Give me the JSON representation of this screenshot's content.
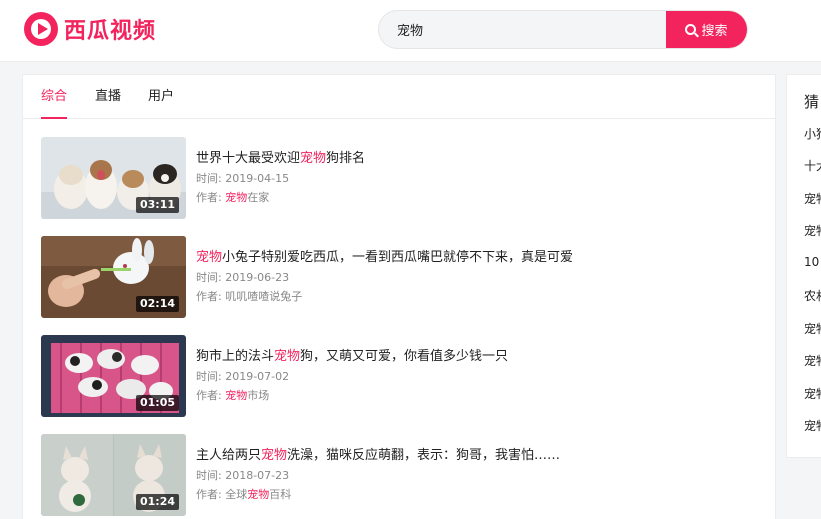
{
  "logo": {
    "text": "西瓜视频",
    "brand_color": "#f2235d"
  },
  "search": {
    "value": "宠物",
    "button_label": "搜索"
  },
  "tabs": [
    {
      "label": "综合",
      "active": true
    },
    {
      "label": "直播",
      "active": false
    },
    {
      "label": "用户",
      "active": false
    }
  ],
  "videos": [
    {
      "title_pre": "世界十大最受欢迎",
      "title_hl": "宠物",
      "title_post": "狗排名",
      "time_label": "时间: ",
      "time": "2019-04-15",
      "author_label": "作者: ",
      "author_hl": "宠物",
      "author_post": "在家",
      "duration": "03:11"
    },
    {
      "title_pre": "",
      "title_hl": "宠物",
      "title_post": "小兔子特别爱吃西瓜，一看到西瓜嘴巴就停不下来，真是可爱",
      "time_label": "时间: ",
      "time": "2019-06-23",
      "author_label": "作者: ",
      "author_hl": "",
      "author_post": "叽叽喳喳说兔子",
      "duration": "02:14"
    },
    {
      "title_pre": "狗市上的法斗",
      "title_hl": "宠物",
      "title_post": "狗，又萌又可爱，你看值多少钱一只",
      "time_label": "时间: ",
      "time": "2019-07-02",
      "author_label": "作者: ",
      "author_hl": "宠物",
      "author_post": "市场",
      "duration": "01:05"
    },
    {
      "title_pre": "主人给两只",
      "title_hl": "宠物",
      "title_post": "洗澡，猫咪反应萌翻，表示：狗哥，我害怕……",
      "time_label": "时间: ",
      "time": "2018-07-23",
      "author_label": "作者: 全球",
      "author_hl": "宠物",
      "author_post": "百科",
      "duration": "01:24"
    }
  ],
  "sidebar": {
    "title": "猜",
    "items": [
      "小狗",
      "十大",
      "宠物",
      "宠物",
      "10",
      "农村",
      "宠物",
      "宠物",
      "宠物",
      "宠物"
    ]
  }
}
